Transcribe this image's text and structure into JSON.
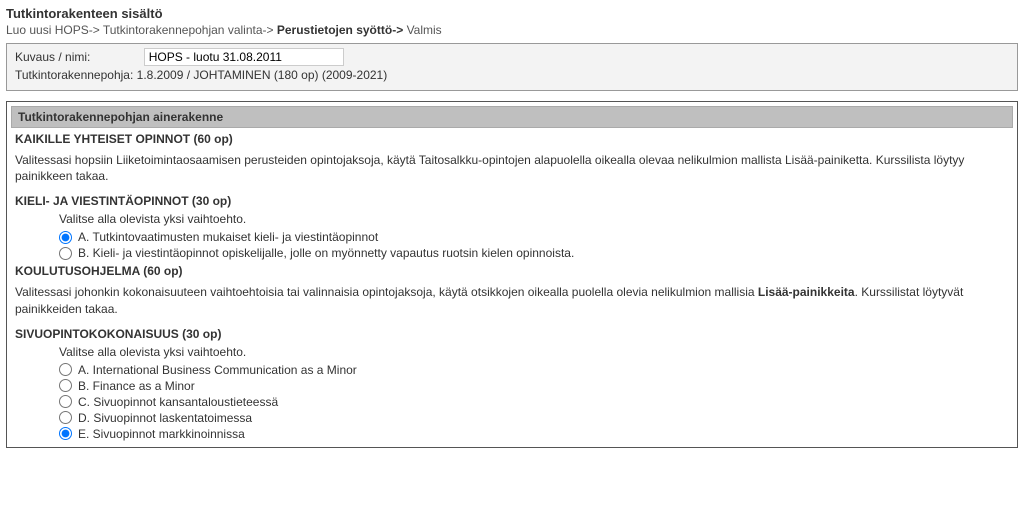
{
  "page_title": "Tutkintorakenteen sisältö",
  "breadcrumb": {
    "items": [
      {
        "label": "Luo uusi HOPS->",
        "active": false
      },
      {
        "label": "Tutkintorakennepohjan valinta->",
        "active": false
      },
      {
        "label": "Perustietojen syöttö->",
        "active": true
      },
      {
        "label": "Valmis",
        "active": false
      }
    ]
  },
  "info": {
    "desc_label": "Kuvaus / nimi:",
    "desc_value": "HOPS - luotu 31.08.2011",
    "struct_label": "Tutkintorakennepohja:",
    "struct_value": "1.8.2009 / JOHTAMINEN (180 op) (2009-2021)"
  },
  "content": {
    "heading": "Tutkintorakennepohjan ainerakenne",
    "common": {
      "title": "KAIKILLE YHTEISET OPINNOT (60 op)",
      "text": "Valitessasi hopsiin Liiketoimintaosaamisen perusteiden opintojaksoja, käytä Taitosalkku-opintojen alapuolella oikealla olevaa nelikulmion mallista Lisää-painiketta. Kurssilista löytyy painikkeen takaa."
    },
    "lang": {
      "title": "KIELI- JA VIESTINTÄOPINNOT (30 op)",
      "instruction": "Valitse alla olevista yksi vaihtoehto.",
      "options": [
        {
          "label": "A. Tutkintovaatimusten mukaiset kieli- ja viestintäopinnot",
          "checked": true
        },
        {
          "label": "B. Kieli- ja viestintäopinnot opiskelijalle, jolle on myönnetty vapautus ruotsin kielen opinnoista.",
          "checked": false
        }
      ]
    },
    "program": {
      "title": "KOULUTUSOHJELMA (60 op)",
      "text_pre": "Valitessasi johonkin kokonaisuuteen vaihtoehtoisia tai valinnaisia opintojaksoja, käytä otsikkojen oikealla puolella olevia nelikulmion mallisia ",
      "text_bold": "Lisää-painikkeita",
      "text_post": ". Kurssilistat löytyvät painikkeiden takaa."
    },
    "minor": {
      "title": "SIVUOPINTOKOKONAISUUS (30 op)",
      "instruction": "Valitse alla olevista yksi vaihtoehto.",
      "options": [
        {
          "label": "A. International Business Communication as a Minor",
          "checked": false
        },
        {
          "label": "B. Finance as a Minor",
          "checked": false
        },
        {
          "label": "C. Sivuopinnot kansantaloustieteessä",
          "checked": false
        },
        {
          "label": "D. Sivuopinnot laskentatoimessa",
          "checked": false
        },
        {
          "label": "E. Sivuopinnot markkinoinnissa",
          "checked": true
        }
      ]
    }
  }
}
